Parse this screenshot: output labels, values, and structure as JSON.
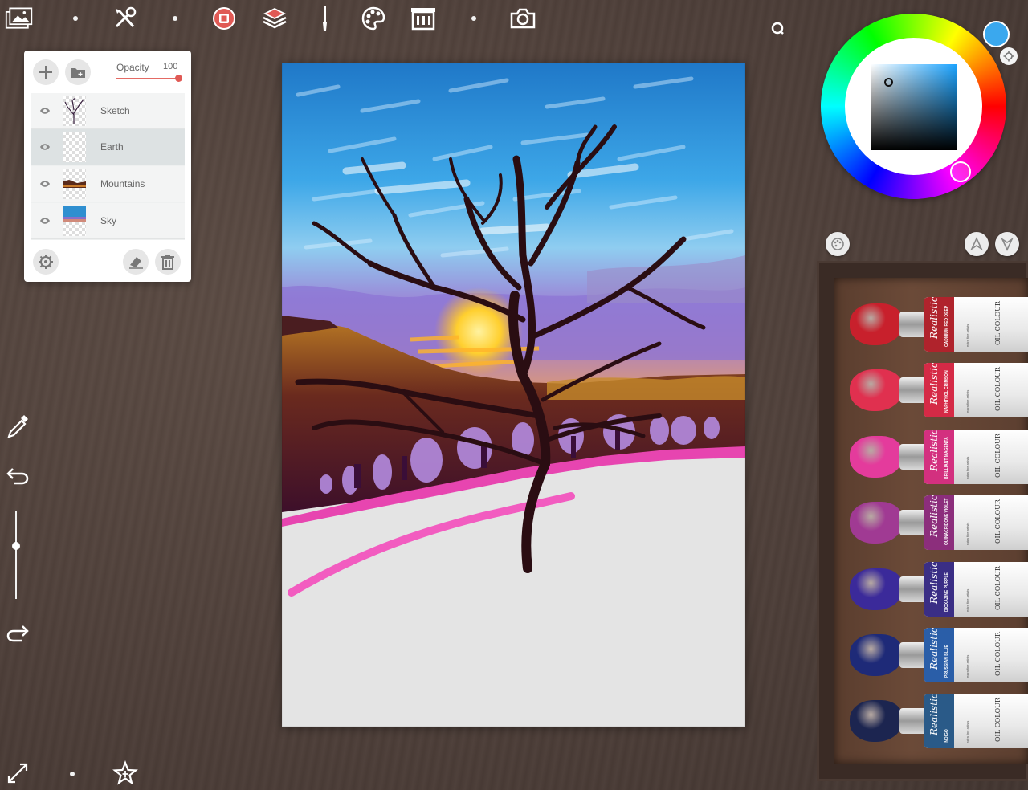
{
  "toolbar": {
    "icons": [
      "gallery-icon",
      "tools-icon",
      "record-icon",
      "layers-icon",
      "brush-icon",
      "palette-icon",
      "reference-icon",
      "camera-icon"
    ]
  },
  "layers_panel": {
    "opacity_label": "Opacity",
    "opacity_value": "100",
    "opacity_fraction": 1.0,
    "layers": [
      {
        "name": "Sketch",
        "visible": true,
        "active": false
      },
      {
        "name": "Earth",
        "visible": true,
        "active": true
      },
      {
        "name": "Mountains",
        "visible": true,
        "active": false
      },
      {
        "name": "Sky",
        "visible": true,
        "active": false
      }
    ]
  },
  "brush_size_fraction": 0.6,
  "color_picker": {
    "current_color": "#3aa8ee",
    "accent": "#e05a55"
  },
  "paint_tubes": [
    {
      "brand": "Realistic",
      "name": "CADMIUM RED DEEP",
      "color": "#c8202c",
      "label_color": "#b0232c"
    },
    {
      "brand": "Realistic",
      "name": "NAPHTHOL CRIMSON",
      "color": "#e0304f",
      "label_color": "#d52a46"
    },
    {
      "brand": "Realistic",
      "name": "BRILLIANT MAGENTA",
      "color": "#e43b9c",
      "label_color": "#d3307f"
    },
    {
      "brand": "Realistic",
      "name": "QUINACRIDONE VIOLET",
      "color": "#a03a93",
      "label_color": "#8c2e7c"
    },
    {
      "brand": "Realistic",
      "name": "DIOXAZINE PURPLE",
      "color": "#3b2a9a",
      "label_color": "#3a2e85"
    },
    {
      "brand": "Realistic",
      "name": "PRUSSIAN BLUE",
      "color": "#1e2a78",
      "label_color": "#2a5ea8"
    },
    {
      "brand": "Realistic",
      "name": "INDIGO",
      "color": "#1c2550",
      "label_color": "#2a5a88"
    }
  ],
  "tube_common": {
    "oil_text": "OIL COLOUR",
    "fine_text": "extra fine artists"
  }
}
